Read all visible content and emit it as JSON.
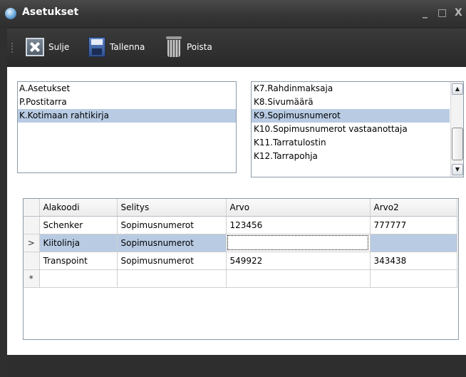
{
  "window": {
    "title": "Asetukset",
    "controls": {
      "minimize": "_",
      "maximize": "□",
      "close": "X"
    }
  },
  "toolbar": {
    "close_label": "Sulje",
    "save_label": "Tallenna",
    "delete_label": "Poista"
  },
  "left_list": {
    "items": [
      "A.Asetukset",
      "P.Postitarra",
      "K.Kotimaan rahtikirja"
    ],
    "selected_index": 2
  },
  "right_list": {
    "items": [
      "K7.Rahdinmaksaja",
      "K8.Sivumäärä",
      "K9.Sopimusnumerot",
      "K10.Sopimusnumerot vastaanottaja",
      "K11.Tarratulostin",
      "K12.Tarrapohja"
    ],
    "selected_index": 2,
    "scroll_up": "▲",
    "scroll_down": "▼"
  },
  "grid": {
    "columns": [
      "Alakoodi",
      "Selitys",
      "Arvo",
      "Arvo2"
    ],
    "rows": [
      {
        "marker": "",
        "cells": [
          "Schenker",
          "Sopimusnumerot",
          "123456",
          "777777"
        ]
      },
      {
        "marker": ">",
        "cells": [
          "Kiitolinja",
          "Sopimusnumerot",
          "",
          ""
        ]
      },
      {
        "marker": "",
        "cells": [
          "Transpoint",
          "Sopimusnumerot",
          "549922",
          "343438"
        ]
      }
    ],
    "new_row_marker": "*",
    "selected_row": 1
  },
  "colors": {
    "selection": "#b8cbe3",
    "frame": "#2b2b2b"
  }
}
